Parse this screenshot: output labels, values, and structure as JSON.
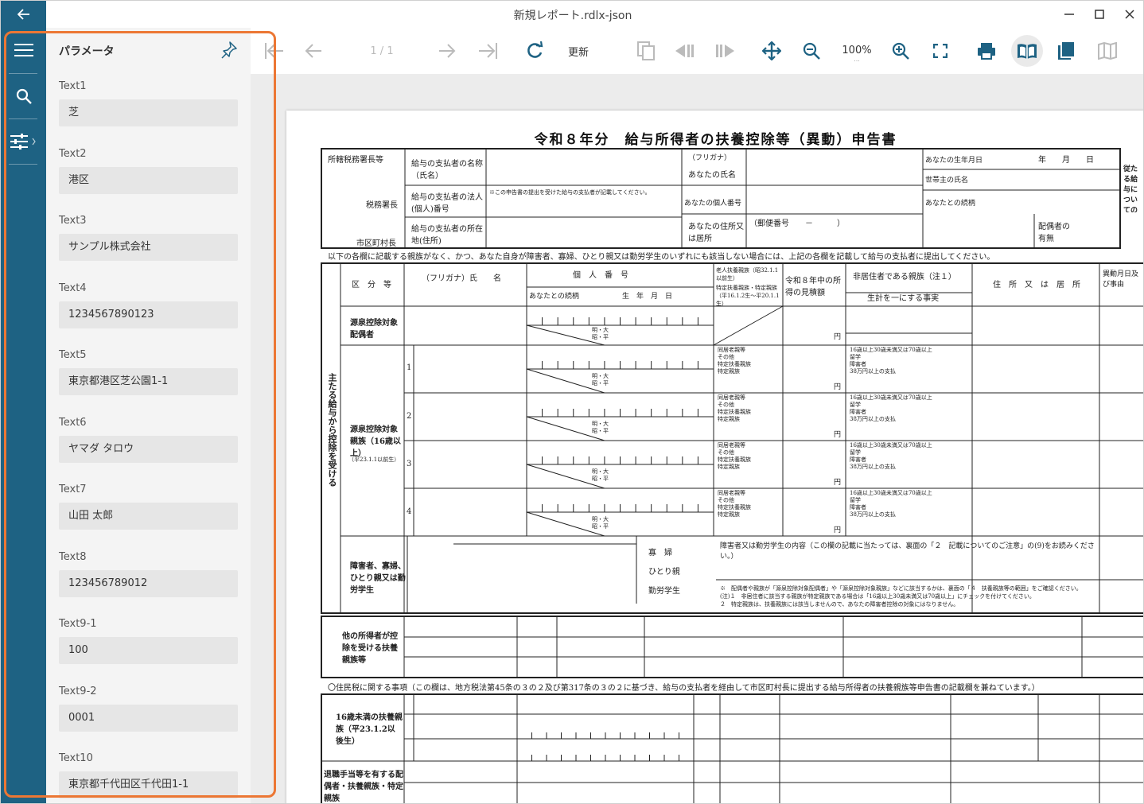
{
  "window": {
    "title": "新規レポート.rdlx-json"
  },
  "panel": {
    "title": "パラメータ",
    "params": [
      {
        "label": "Text1",
        "value": "芝"
      },
      {
        "label": "Text2",
        "value": "港区"
      },
      {
        "label": "Text3",
        "value": "サンプル株式会社"
      },
      {
        "label": "Text4",
        "value": "1234567890123"
      },
      {
        "label": "Text5",
        "value": "東京都港区芝公園1-1"
      },
      {
        "label": "Text6",
        "value": "ヤマダ タロウ"
      },
      {
        "label": "Text7",
        "value": "山田 太郎"
      },
      {
        "label": "Text8",
        "value": "123456789012"
      },
      {
        "label": "Text9-1",
        "value": "100"
      },
      {
        "label": "Text9-2",
        "value": "0001"
      },
      {
        "label": "Text10",
        "value": "東京都千代田区千代田1-1"
      }
    ]
  },
  "toolbar": {
    "page_indicator": "1 / 1",
    "refresh_label": "更新",
    "zoom": "100%",
    "zoom_more": "..."
  },
  "icons": {
    "back": "back-arrow-icon",
    "menu": "hamburger-menu-icon",
    "search": "search-icon",
    "params": "sliders-icon",
    "pin": "pin-icon"
  },
  "colors": {
    "rail": "#1e6283",
    "highlight": "#ec7734",
    "accent": "#1e6283"
  },
  "document": {
    "title": "令和８年分　給与所得者の扶養控除等（異動）申告書",
    "header": {
      "tax_office": "所轄税務署長等",
      "tax_office_chief": "税務署長",
      "city_chief": "市区町村長",
      "payer_name": "給与の支払者の名称（氏名）",
      "payer_number": "給与の支払者の法人(個人)番号",
      "payer_number_note": "※この申告書の提出を受けた給与の支払者が記載してください。",
      "payer_address": "給与の支払者の所在地(住所)",
      "furigana": "（フリガナ）",
      "your_name": "あなたの氏名",
      "your_number": "あなたの個人番号",
      "your_address": "あなたの住所又は居所",
      "postal": "（郵便番号　　－　　　）",
      "birthdate": "あなたの生年月日",
      "date_parts": "年　　月　　日",
      "householder": "世帯主の氏名",
      "relation": "あなたとの続柄",
      "spouse": "配偶者の有無",
      "right_cut": "従たる給与についての扶養控除等申告書"
    },
    "note_line": "以下の各欄に記載する親族がなく、かつ、あなた自身が障害者、寡婦、ひとり親又は勤労学生のいずれにも該当しない場合には、上記の各欄を記載して給与の支払者に提出してください。",
    "section_side": "主たる給与から控除を受ける",
    "col_headers": {
      "category": "区　分　等",
      "name": "（フリガナ）氏　　名",
      "number": "個　人　番　号",
      "relation": "あなたとの続柄",
      "birth": "生　年　月　日",
      "elderly": "老人扶養親族（昭32.1.1以前生）",
      "specific": "特定扶養親族・特定親族（平16.1.2生〜平20.1.1生）",
      "income": "令和８年中の所得の見積額",
      "nonresident": "非居住者である親族（注１）",
      "nonresident_sub": "生計を一にする事実",
      "address": "住　所　又　は　居　所",
      "change": "異動月日及び事由"
    },
    "row_a": "源泉控除対象配偶者",
    "row_b": "源泉控除対象親族（16歳以上）",
    "row_b_sub": "（平23.1.1以前生）",
    "row_c": "障害者、寡婦、ひとり親又は勤労学生",
    "row_c_detail": "障害者又は勤労学生の内容（この欄の記載に当たっては、裏面の「２　記載についてのご注意」の(9)をお読みください。）",
    "row_d": "他の所得者が控除を受ける扶養親族等",
    "era_small": "明・大\n昭・平",
    "yen": "円",
    "resident_note": "〇住民税に関する事項（この欄は、地方税法第45条の３の２及び第317条の３の２に基づき、給与の支払者を経由して市区町村長に提出する給与所得者の扶養親族等申告書の記載欄を兼ねています。）",
    "under16": "16歳未満の扶養親族（平23.1.2以後生）",
    "retire": "退職手当等を有する配偶者・扶養親族・特定親族",
    "nonres_box": "16歳以上30歳未満又は70歳以上\n留学\n障害者\n38万円以上の支払",
    "elderly_box": "同居老親等\nその他\n特定扶養親族\n特定親族",
    "c_items": "寡　婦\nひとり親\n勤労学生",
    "c_notes": "※　配偶者や親族が「源泉控除対象配偶者」や「源泉控除対象親族」などに該当するかは、裏面の「４　扶養親族等の範囲」をご確認ください。\n(注)１　非居住者に該当する親族が特定親族である場合は「16歳以上30歳未満又は70歳以上」にチェックを付けてください。\n２　特定親族は、扶養親族には該当しませんので、あなたの障害者控除の対象にはなりません。"
  }
}
